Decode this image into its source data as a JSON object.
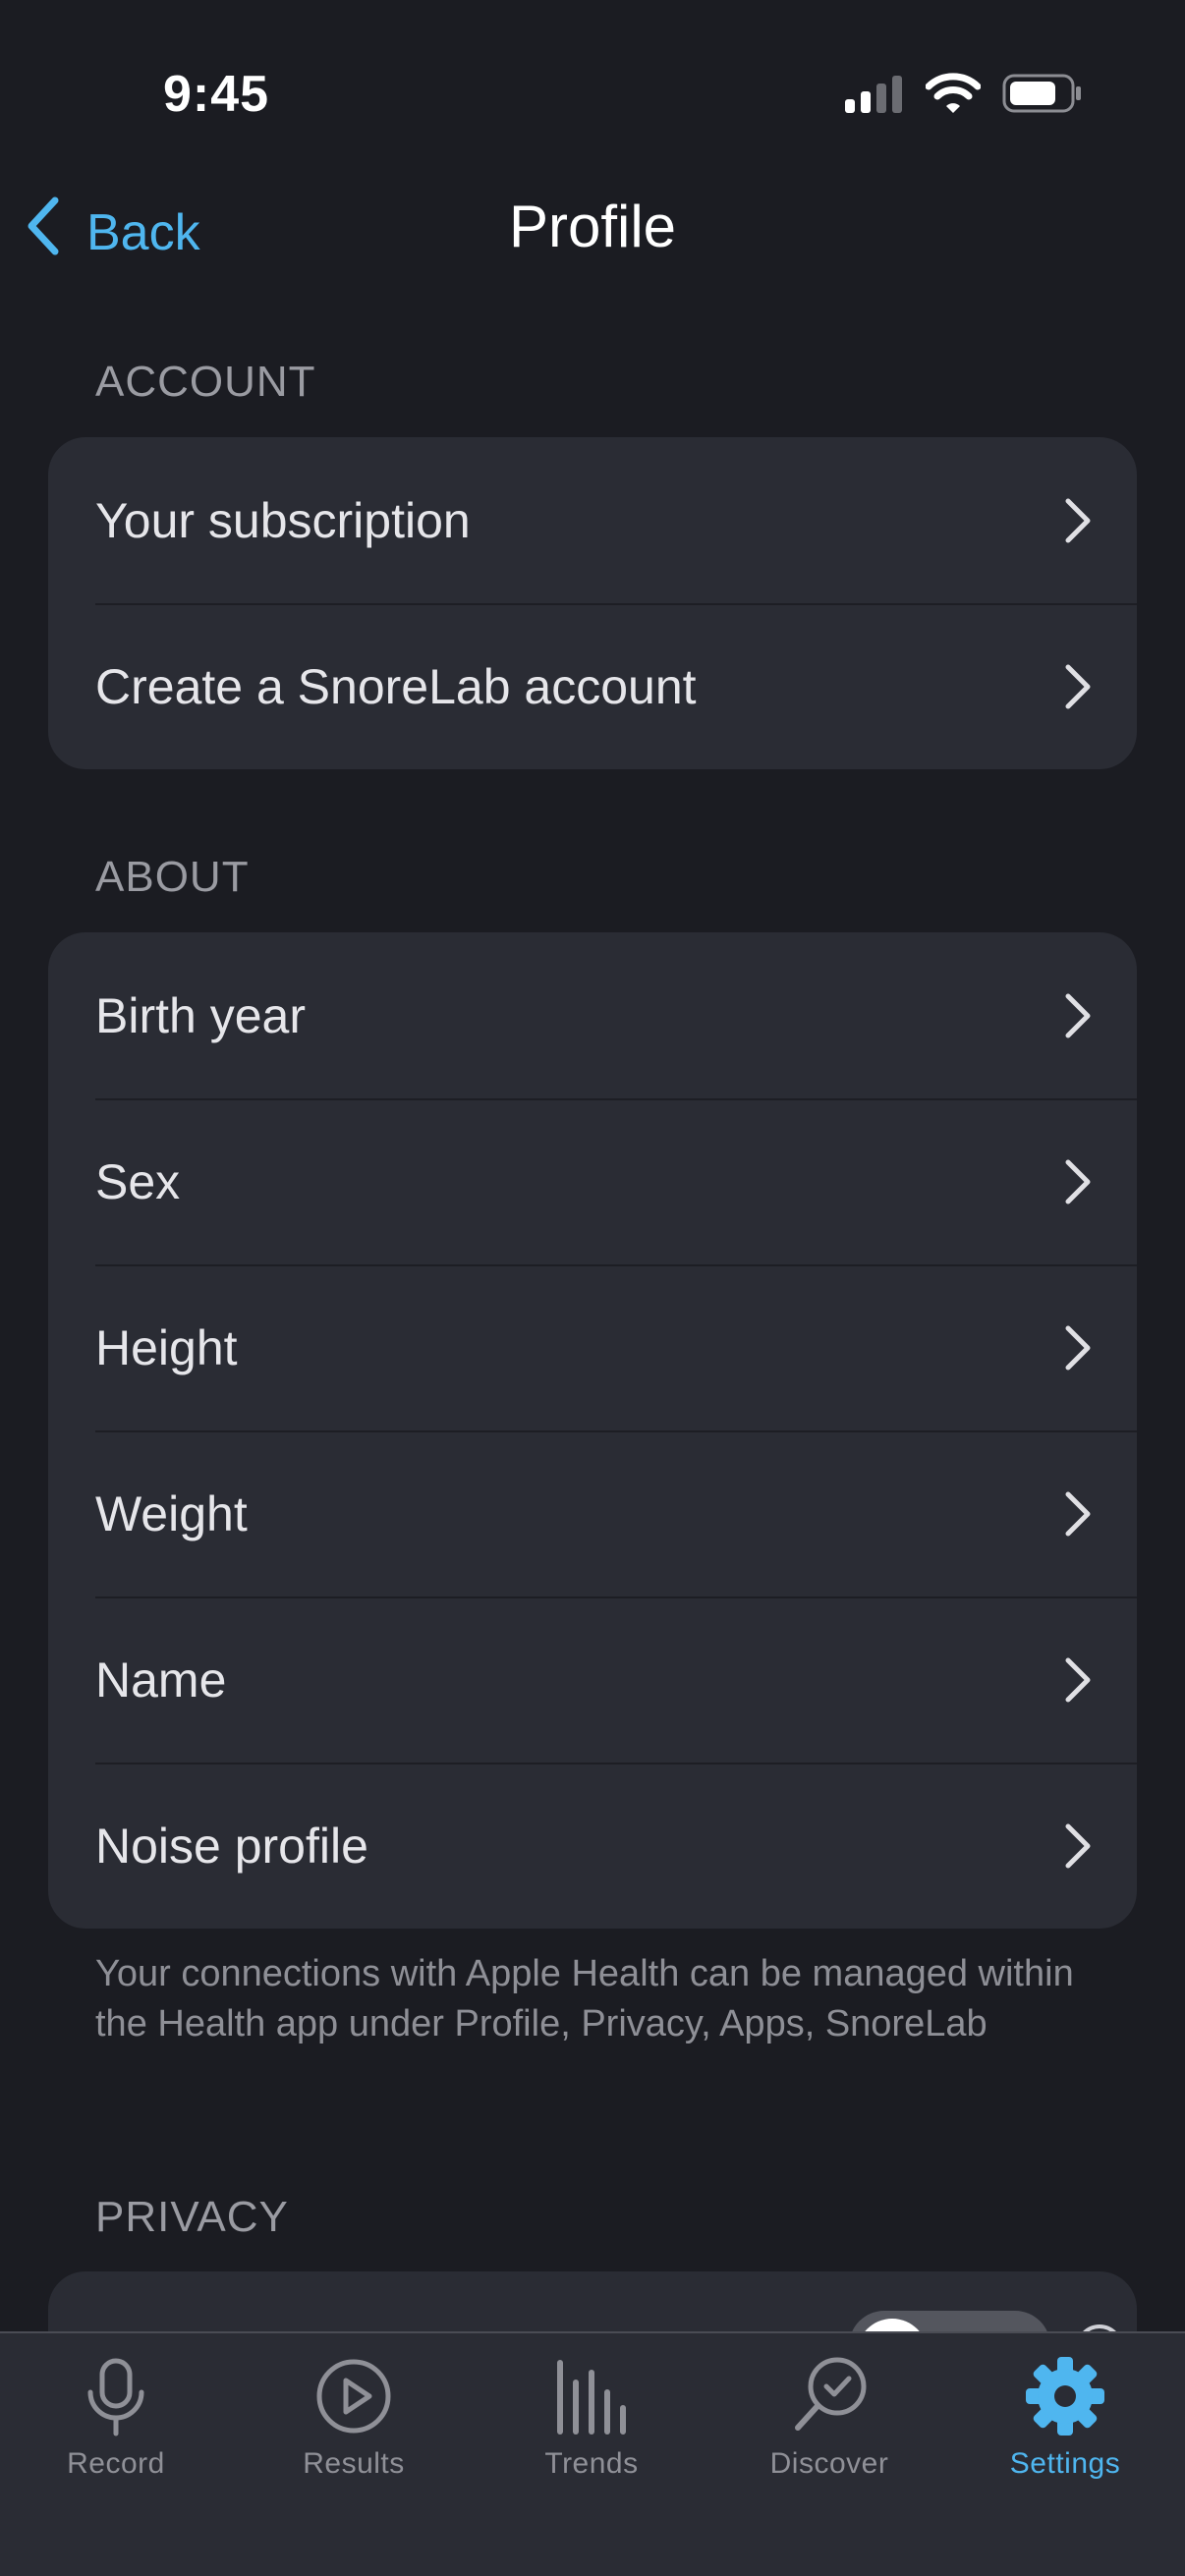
{
  "status_bar": {
    "time": "9:45"
  },
  "nav": {
    "back_label": "Back",
    "title": "Profile"
  },
  "sections": {
    "account": {
      "header": "ACCOUNT",
      "items": [
        {
          "label": "Your subscription"
        },
        {
          "label": "Create a SnoreLab account"
        }
      ]
    },
    "about": {
      "header": "ABOUT",
      "items": [
        {
          "label": "Birth year"
        },
        {
          "label": "Sex"
        },
        {
          "label": "Height"
        },
        {
          "label": "Weight"
        },
        {
          "label": "Name"
        },
        {
          "label": "Noise profile"
        }
      ],
      "footnote": "Your connections with Apple Health can be managed within the Health app under Profile, Privacy, Apps, SnoreLab"
    },
    "privacy": {
      "header": "PRIVACY"
    }
  },
  "tabbar": {
    "tabs": [
      {
        "label": "Record",
        "icon": "microphone-icon"
      },
      {
        "label": "Results",
        "icon": "play-circle-icon"
      },
      {
        "label": "Trends",
        "icon": "bar-chart-icon"
      },
      {
        "label": "Discover",
        "icon": "search-check-icon"
      },
      {
        "label": "Settings",
        "icon": "gear-icon",
        "active": true
      }
    ]
  },
  "colors": {
    "accent": "#4fb6ef",
    "background": "#1b1c22",
    "card": "#2a2c34"
  }
}
